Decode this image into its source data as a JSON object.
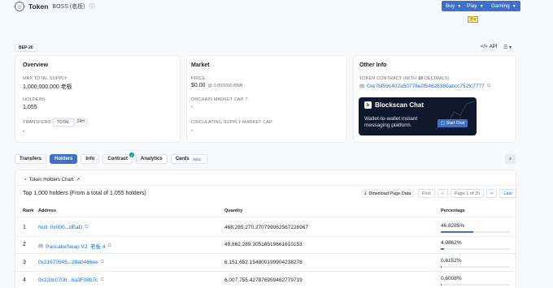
{
  "header": {
    "token_word": "Token",
    "token_name": "BOSS (老板)",
    "buttons": [
      {
        "label": "Buy"
      },
      {
        "label": "Play"
      },
      {
        "label": "Gaming"
      }
    ],
    "lang_badge": "文/£"
  },
  "bep_badge": "BEP-20",
  "api_label": "API",
  "overview": {
    "title": "Overview",
    "max_supply_label": "MAX TOTAL SUPPLY",
    "max_supply_value": "1,000,000,000 老板",
    "holders_label": "HOLDERS",
    "holders_value": "1,055",
    "transfers_label": "TRANSFERS",
    "transfers_pills": [
      "TOTAL",
      "24H"
    ],
    "transfers_value": "-"
  },
  "market": {
    "title": "Market",
    "price_label": "PRICE",
    "price_value": "$0.00",
    "price_bnb": "@ 0.000000 BNB",
    "onchain_cap_label": "ONCHAIN MARKET CAP",
    "onchain_cap_value": "-",
    "circ_cap_label": "CIRCULATING SUPPLY MARKET CAP",
    "circ_cap_value": "-"
  },
  "other_info": {
    "title": "Other Info",
    "contract_label_pre": "TOKEN CONTRACT (WITH ",
    "contract_decimals": "18",
    "contract_label_post": " DECIMALS)",
    "contract_address": "0xe7bf59c402a50778e2f54626380abcc752fc7777"
  },
  "ad": {
    "brand": "Blockscan Chat",
    "text_line1": "Wallet-to-wallet instant",
    "text_line2": "messaging platform.",
    "cta": "Start Chat"
  },
  "tabs": [
    {
      "label": "Transfers",
      "active": false
    },
    {
      "label": "Holders",
      "active": true
    },
    {
      "label": "Info",
      "active": false
    },
    {
      "label": "Contract",
      "active": false
    },
    {
      "label": "Analytics",
      "active": false
    },
    {
      "label": "Cards",
      "active": false,
      "badge": "New"
    }
  ],
  "holders": {
    "chart_link": "Token Holders Chart",
    "summary": "Top 1,000 holders (From a total of 1,055 holders)",
    "download_label": "Download Page Data",
    "pager": {
      "first": "First",
      "prev": "<",
      "page": "Page 1 of 20",
      "next": ">",
      "last": "Last"
    },
    "columns": {
      "rank": "Rank",
      "address": "Address",
      "quantity": "Quantity",
      "percentage": "Percentage"
    },
    "rows": [
      {
        "rank": "1",
        "address": "Null: 0x000...dEaD",
        "quantity": "468,285,270.270799062567226967",
        "percentage": "46.8285%",
        "pct_value": 46.8285
      },
      {
        "rank": "2",
        "address": "PancakeSwap V2: 老板 4",
        "quantity": "49,862,289.30518519661610153",
        "percentage": "4.9862%",
        "pct_value": 4.9862
      },
      {
        "rank": "3",
        "address": "0x21670545...28a0466ee",
        "quantity": "6,151,652.154800199904238278",
        "percentage": "0.6152%",
        "pct_value": 0.6152
      },
      {
        "rank": "4",
        "address": "0x22dc0708...6a3F08b7c",
        "quantity": "6,007,755.427876959462779719",
        "percentage": "0.6008%",
        "pct_value": 0.6008
      }
    ]
  }
}
